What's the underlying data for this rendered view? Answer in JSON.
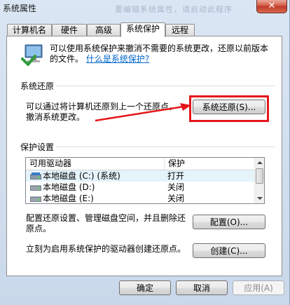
{
  "window": {
    "title": "系统属性",
    "ghost_text": "要编辑系统属性，请启动此程序"
  },
  "tabs": [
    {
      "label": "计算机名"
    },
    {
      "label": "硬件"
    },
    {
      "label": "高级"
    },
    {
      "label": "系统保护"
    },
    {
      "label": "远程"
    }
  ],
  "intro": {
    "text": "可以使用系统保护来撤消不需要的系统更改，还原以前版本的文件。",
    "link": "什么是系统保护?"
  },
  "restore": {
    "group_label": "系统还原",
    "description": "可以通过将计算机还原到上一个还原点，撤消系统更改。",
    "button": "系统还原(S)..."
  },
  "protection": {
    "group_label": "保护设置",
    "columns": [
      "可用驱动器",
      "保护"
    ],
    "drives": [
      {
        "name": "本地磁盘 (C:) (系统)",
        "status": "打开"
      },
      {
        "name": "本地磁盘 (D:)",
        "status": "关闭"
      },
      {
        "name": "本地磁盘 (E:)",
        "status": "关闭"
      }
    ],
    "configure_text": "配置还原设置、管理磁盘空间，并且删除还原点。",
    "configure_button": "配置(O)...",
    "create_text": "立刻为启用系统保护的驱动器创建还原点。",
    "create_button": "创建(C)..."
  },
  "footer": {
    "ok": "确定",
    "cancel": "取消",
    "apply": "应用(A)"
  },
  "colors": {
    "annotation": "#e5161b",
    "link": "#0066cc"
  }
}
